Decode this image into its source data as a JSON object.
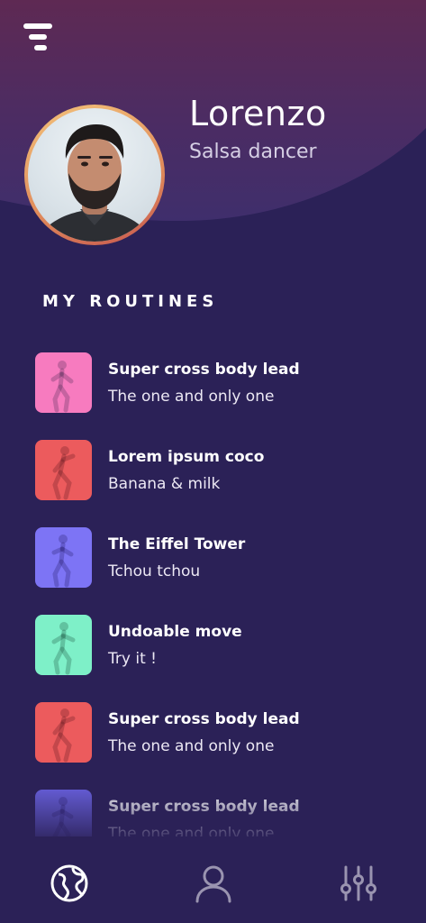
{
  "profile": {
    "name": "Lorenzo",
    "role": "Salsa dancer"
  },
  "section": {
    "title": "MY ROUTINES"
  },
  "routines": [
    {
      "title": "Super cross body lead",
      "subtitle": "The one and only one",
      "color": "#f77bbf"
    },
    {
      "title": "Lorem ipsum coco",
      "subtitle": "Banana & milk",
      "color": "#ec5b5d"
    },
    {
      "title": "The Eiffel Tower",
      "subtitle": "Tchou tchou",
      "color": "#7d74f5"
    },
    {
      "title": "Undoable move",
      "subtitle": "Try it !",
      "color": "#7ef0c8"
    },
    {
      "title": "Super cross body lead",
      "subtitle": "The one and only one",
      "color": "#ec5b5d"
    },
    {
      "title": "Super cross body lead",
      "subtitle": "The one and only one",
      "color": "#6a62e0"
    }
  ],
  "nav": {
    "items": [
      {
        "icon": "globe-icon",
        "active": true
      },
      {
        "icon": "user-icon",
        "active": false
      },
      {
        "icon": "sliders-icon",
        "active": false
      }
    ]
  },
  "colors": {
    "background": "#2b2157",
    "header": "#4b2c62",
    "accent_ring": "#e08a5a"
  }
}
